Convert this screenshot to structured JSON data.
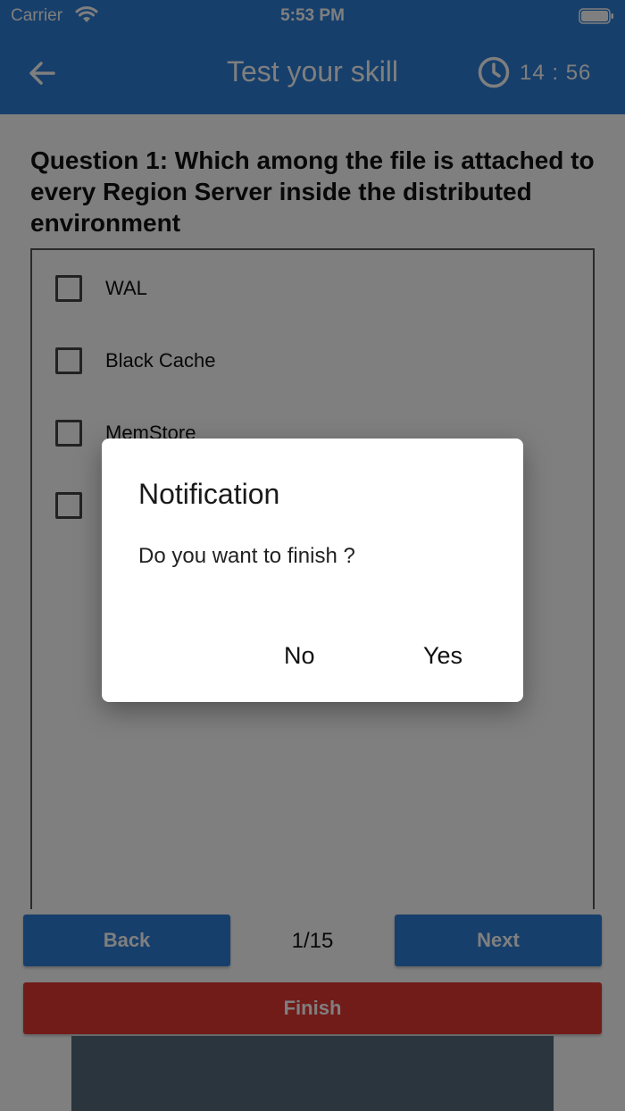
{
  "status_bar": {
    "carrier": "Carrier",
    "time": "5:53 PM"
  },
  "app_bar": {
    "title": "Test your skill",
    "timer": "14 : 56",
    "color": "#2f7fd6"
  },
  "question": {
    "text": "Question 1: Which among the file is attached to every Region Server inside the distributed environment",
    "options": [
      "WAL",
      "Black Cache",
      "MemStore",
      ""
    ]
  },
  "navigation": {
    "back_label": "Back",
    "page_counter": "1/15",
    "next_label": "Next",
    "finish_label": "Finish",
    "finish_color": "#e53935"
  },
  "dialog": {
    "title": "Notification",
    "message": "Do you want to finish ?",
    "no_label": "No",
    "yes_label": "Yes"
  }
}
